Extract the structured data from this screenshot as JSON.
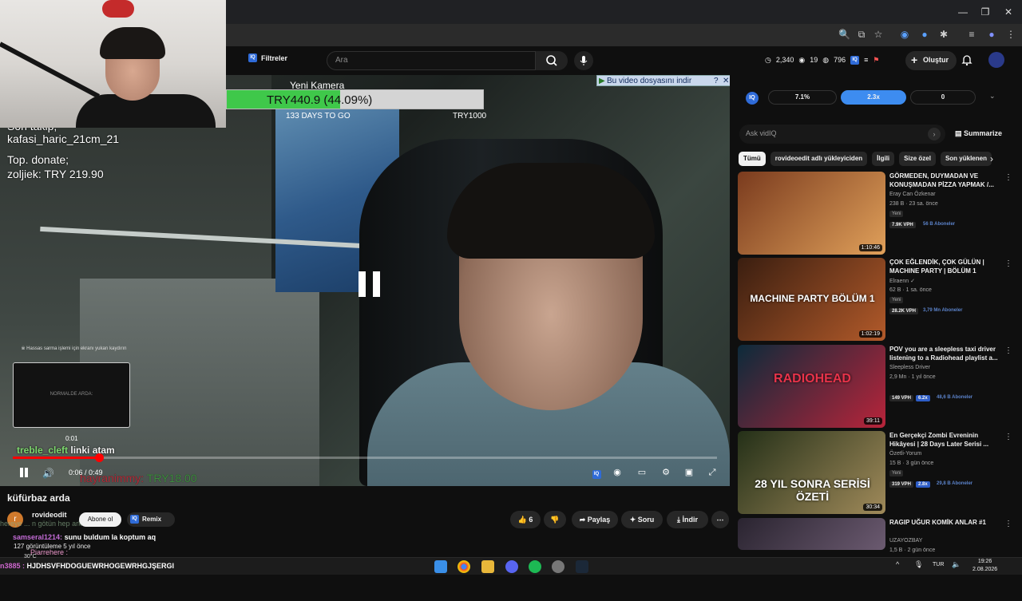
{
  "browser": {
    "window_controls": [
      "—",
      "❐",
      "✕"
    ]
  },
  "yt_header": {
    "filters_label": "Filtreler",
    "search_placeholder": "Ara",
    "stats": {
      "views": "2,340",
      "watching": "19",
      "followers": "796"
    },
    "create_label": "Oluştur"
  },
  "stream_overlay": {
    "goal_title": "Yeni Kamera",
    "goal_text": "TRY440.9 (44.09%)",
    "goal_progress": 0.4409,
    "goal_days": "133 DAYS TO GO",
    "goal_target": "TRY1000",
    "download_label": "Bu video dosyasını indir",
    "follow_line1": "Son takip;",
    "follow_line2": "kafasi_haric_21cm_21",
    "donate_line1": "Top. donate;",
    "donate_line2": "zoljiek: TRY 219.90",
    "sensitive_note": "※ Hassas sarma işlemi için ekranı yukarı kaydırın",
    "preview_label": "NORMALDE ARDA:",
    "preview_time": "0:01",
    "chat_user": "treble_cleft",
    "chat_text": "linki atam",
    "donor_name": "hayranimmy:",
    "donor_amount": "TRY18.00"
  },
  "player": {
    "time": "0:06 / 0:49",
    "progress": 0.1224
  },
  "below_video": {
    "title": "küfürbaz arda",
    "channel_initial": "r",
    "channel_name": "rovideodit",
    "subscribe_label": "Abone ol",
    "remix_label": "Remix",
    "like_count": "6",
    "share_label": "Paylaş",
    "ask_label": "Soru",
    "download_label": "İndir",
    "chat_ghost": "hereye ... n götün hep arka",
    "chat2_user": "samseral1214:",
    "chat2_text": "sunu buldum la koptum aq",
    "views_line": "127 görüntüleme  5 yıl önce"
  },
  "sidepanel": {
    "iq_pills": [
      "7.1%",
      "2.3x",
      "0"
    ],
    "ask_placeholder": "Ask vidIQ",
    "summarize_label": "Summarize",
    "chips": [
      "Tümü",
      "rovideoedit adlı yükleyiciden",
      "İlgili",
      "Size özel",
      "Son yüklenen"
    ],
    "videos": [
      {
        "title": "GÖRMEDEN, DUYMADAN VE KONUŞMADAN PİZZA YAPMAK /...",
        "channel": "Eray Can Özkenar",
        "meta": "238 B · 23 sa. önce",
        "badge": "Yeni",
        "vph": "7.9K VPH",
        "mult": "",
        "subs": "56 B Aboneler",
        "duration": "1:10:46",
        "c1": "#7a3b1e",
        "c2": "#e0a05a"
      },
      {
        "title": "ÇOK EĞLENDİK, ÇOK GÜLÜN | MACHINE PARTY | BÖLÜM 1",
        "channel": "Elraenn ✓",
        "meta": "62 B · 1 sa. önce",
        "badge": "Yeni",
        "vph": "28.2K VPH",
        "mult": "",
        "subs": "3,79 Mn Aboneler",
        "duration": "1:02:19",
        "c1": "#3a1e10",
        "c2": "#b25a2a"
      },
      {
        "title": "POV you are a sleepless taxi driver listening to a Radiohead playlist a...",
        "channel": "Sleepless Driver",
        "meta": "2,9 Mn · 1 yıl önce",
        "badge": "",
        "vph": "149 VPH",
        "mult": "6.2x",
        "subs": "48,6 B Aboneler",
        "duration": "39:11",
        "c1": "#0c2a3a",
        "c2": "#b8243a"
      },
      {
        "title": "En Gerçekçi Zombi Evreninin Hikâyesi | 28 Days Later Serisi ...",
        "channel": "Özetli-Yorum",
        "meta": "15 B · 3 gün önce",
        "badge": "Yeni",
        "vph": "319 VPH",
        "mult": "2.8x",
        "subs": "29,8 B Aboneler",
        "duration": "30:34",
        "c1": "#243018",
        "c2": "#a08a5a"
      },
      {
        "title": "RAGIP UĞUR KOMİK ANLAR #1",
        "channel": "UZAYOZBAY",
        "meta": "1,5 B · 2 gün önce",
        "badge": "",
        "vph": "",
        "mult": "",
        "subs": "",
        "duration": "",
        "c1": "#2a2430",
        "c2": "#6b5a70"
      }
    ],
    "thumb_text_1": "MACHINE PARTY BÖLÜM 1",
    "thumb_text_2": "RADIOHEAD",
    "thumb_text_3": "28 YIL SONRA SERİSİ ÖZETİ"
  },
  "taskbar": {
    "weather": "30°C",
    "ticker_prefix": "n3885 :",
    "ticker": "HJDHSVFHDOGUEWRHOGEWRHGJŞERGI",
    "user_line": "Piarrehere :",
    "lang": "TUR",
    "time": "19:26",
    "date": "2.08.2026"
  }
}
